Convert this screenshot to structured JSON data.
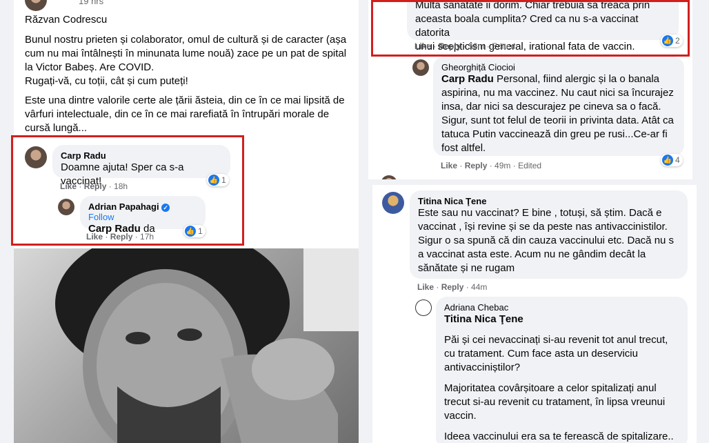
{
  "post": {
    "time": "19 hrs",
    "author_name": "Răzvan Codrescu",
    "paragraph1": "Bunul nostru prieten și colaborator, omul de cultură și de caracter (așa cum nu mai întâlnești în minunata lume nouă) zace pe un pat de spital la Victor Babeș. Are COVID.",
    "paragraph2": "Rugați-vă, cu toții, cât și cum puteți!",
    "paragraph3": "Este una dintre valorile certe ale țării ăsteia, din ce în ce mai lipsită de vârfuri intelectuale, din ce în ce mai rarefiată în întrupări morale de cursă lungă..."
  },
  "left_comments": [
    {
      "author": "Carp Radu",
      "text": "Doamne ajuta! Sper ca s-a vaccinat!",
      "like": "Like",
      "reply": "Reply",
      "time": "18h",
      "reactions": "1"
    },
    {
      "author": "Adrian Papahagi",
      "follow": "Follow",
      "mention": "Carp Radu",
      "text": "da",
      "like": "Like",
      "reply": "Reply",
      "time": "17h",
      "reactions": "1"
    }
  ],
  "right_top": {
    "lines": [
      "Multa sanatate ii dorim. Chiar trebuia sa treaca prin",
      "aceasta boala cumplita? Cred ca nu s-a vaccinat datorita",
      "unui scepticism general, irational fata de vaccin. Cumplit!"
    ],
    "like": "Like",
    "reply": "Reply",
    "time": "56m",
    "edited": "Edited",
    "reactions": "2"
  },
  "gheorghita": {
    "author": "Gheorghiță Ciocioi",
    "mention": "Carp Radu",
    "text": "Personal, fiind alergic și la o banala aspirina, nu ma vaccinez. Nu caut nici sa încurajez insa, dar nici sa descurajez pe cineva sa o facă. Sigur, sunt tot felul de teorii in privinta data. Atât ca tatuca Putin vaccinează din greu pe rusi...Ce-ar fi fost altfel.",
    "like": "Like",
    "reply": "Reply",
    "time": "49m",
    "edited": "Edited",
    "reactions": "4"
  },
  "titina": {
    "author": "Titina Nica Ţene",
    "text": "Este sau nu vaccinat? E bine , totuși, să știm. Dacă e vaccinat , își revine și se da peste nas antivaccinistilor. Sigur o sa spună că din cauza vaccinului etc. Dacă nu s a vaccinat asta este. Acum nu ne gândim decât la sănătate și ne rugam",
    "like": "Like",
    "reply": "Reply",
    "time": "44m"
  },
  "adriana": {
    "author": "Adriana Chebac",
    "mention": "Titina Nica Ţene",
    "p1": "Păi și cei nevaccinați si-au revenit tot anul trecut, cu tratament. Cum face asta un deserviciu antivacciniștilor?",
    "p2": "Majoritatea covârșitoare a celor spitalizați anul trecut si-au revenit cu tratament, în lipsa vreunui vaccin.",
    "p3": "Ideea vaccinului era sa te ferească de spitalizare.."
  },
  "colors": {
    "highlight_border": "#d21e1e",
    "like_blue": "#1877f2",
    "follow_blue": "#1877f2"
  }
}
